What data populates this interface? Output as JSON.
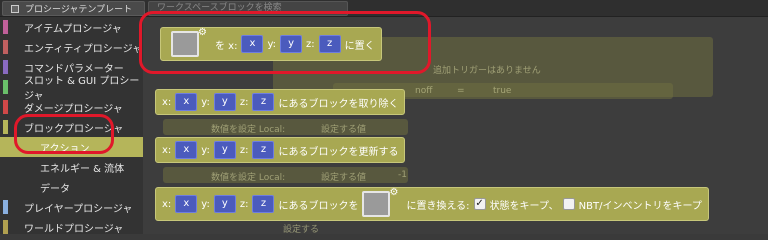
{
  "header": {
    "template_tab": "プロシージャテンプレート",
    "search_placeholder": "ワークスペースブロックを検索"
  },
  "sidebar": {
    "items": [
      {
        "label": "アイテムプロシージャ",
        "color": "#c0609a"
      },
      {
        "label": "エンティティプロシージャ",
        "color": "#c06060"
      },
      {
        "label": "コマンドパラメーター",
        "color": "#8a6ac0"
      },
      {
        "label": "スロット & GUI プロシージャ",
        "color": "#6abf6a"
      },
      {
        "label": "ダメージプロシージャ",
        "color": "#d04848"
      },
      {
        "label": "ブロックプロシージャ",
        "color": "#b5b55a"
      },
      {
        "label": "アクション"
      },
      {
        "label": "エネルギー & 流体"
      },
      {
        "label": "データ"
      },
      {
        "label": "プレイヤープロシージャ",
        "color": "#8ab0e0"
      },
      {
        "label": "ワールドプロシージャ",
        "color": "#b0a050"
      }
    ]
  },
  "background": {
    "trigger_note": "追加トリガーはありません",
    "local_label_1": "数値を設定 Local:",
    "set_value_1": "設定する値",
    "local_label_2": "数値を設定 Local:",
    "set_value_2": "設定する値",
    "minus_one": "-1",
    "on_off": "noff",
    "eq": "=",
    "true_val": "true",
    "bottom_hint": "設定する"
  },
  "blocks": {
    "place": {
      "at_x": "を x:",
      "y": "y:",
      "z": "z:",
      "suffix": "に置く"
    },
    "remove": {
      "x": "x:",
      "y": "y:",
      "z": "z:",
      "suffix": "にあるブロックを取り除く"
    },
    "update": {
      "x": "x:",
      "y": "y:",
      "z": "z:",
      "suffix": "にあるブロックを更新する"
    },
    "replace": {
      "x": "x:",
      "y": "y:",
      "z": "z:",
      "mid": "にあるブロックを",
      "replace_with": "に置き換える:",
      "keep_state": "状態をキープ、",
      "keep_state_checked": true,
      "keep_nbt": "NBT/インベントリをキープ",
      "keep_nbt_checked": false
    },
    "vars": {
      "x": "x",
      "y": "y",
      "z": "z"
    }
  },
  "colors": {
    "block": "#a8a852",
    "variable": "#4b5bbd",
    "highlight": "#e0182a"
  }
}
